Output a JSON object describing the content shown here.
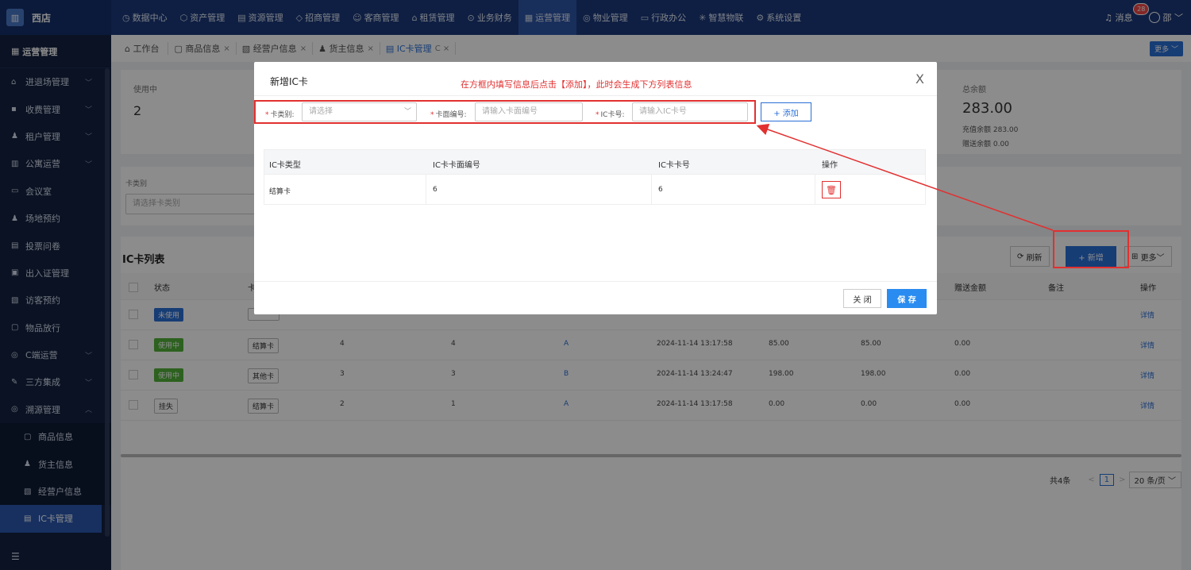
{
  "app": {
    "logo_icon": "building-icon",
    "store_name": "西店"
  },
  "topnav": [
    {
      "icon": "◷",
      "label": "数据中心"
    },
    {
      "icon": "⬡",
      "label": "资产管理"
    },
    {
      "icon": "▤",
      "label": "资源管理"
    },
    {
      "icon": "◇",
      "label": "招商管理"
    },
    {
      "icon": "☺",
      "label": "客商管理"
    },
    {
      "icon": "⌂",
      "label": "租赁管理"
    },
    {
      "icon": "⊙",
      "label": "业务财务"
    },
    {
      "icon": "▦",
      "label": "运营管理"
    },
    {
      "icon": "◎",
      "label": "物业管理"
    },
    {
      "icon": "▭",
      "label": "行政办公"
    },
    {
      "icon": "✳",
      "label": "智慧物联"
    },
    {
      "icon": "⚙",
      "label": "系统设置"
    }
  ],
  "topright": {
    "message_label": "消息",
    "message_count": "28",
    "user_name": "邵"
  },
  "sidebar": {
    "title": "运营管理",
    "items": [
      {
        "icon": "⌂",
        "label": "进退场管理",
        "chev": "﹀"
      },
      {
        "icon": "▪",
        "label": "收费管理",
        "chev": "﹀"
      },
      {
        "icon": "♟",
        "label": "租户管理",
        "chev": "﹀"
      },
      {
        "icon": "▥",
        "label": "公寓运营",
        "chev": "﹀"
      },
      {
        "icon": "▭",
        "label": "会议室",
        "chev": ""
      },
      {
        "icon": "♟",
        "label": "场地预约",
        "chev": ""
      },
      {
        "icon": "▤",
        "label": "投票问卷",
        "chev": ""
      },
      {
        "icon": "▣",
        "label": "出入证管理",
        "chev": ""
      },
      {
        "icon": "▧",
        "label": "访客预约",
        "chev": ""
      },
      {
        "icon": "▢",
        "label": "物品放行",
        "chev": ""
      },
      {
        "icon": "◎",
        "label": "C端运营",
        "chev": "﹀"
      },
      {
        "icon": "✎",
        "label": "三方集成",
        "chev": "﹀"
      },
      {
        "icon": "◎",
        "label": "溯源管理",
        "chev": "︿"
      }
    ],
    "subitems": [
      {
        "icon": "▢",
        "label": "商品信息"
      },
      {
        "icon": "♟",
        "label": "货主信息"
      },
      {
        "icon": "▧",
        "label": "经营户信息"
      },
      {
        "icon": "▤",
        "label": "IC卡管理"
      }
    ],
    "collapse_icon": "☰"
  },
  "tabs": [
    {
      "icon": "⌂",
      "label": "工作台",
      "close": ""
    },
    {
      "icon": "▢",
      "label": "商品信息",
      "close": "×"
    },
    {
      "icon": "▧",
      "label": "经营户信息",
      "close": "×"
    },
    {
      "icon": "♟",
      "label": "货主信息",
      "close": "×"
    },
    {
      "icon": "▤",
      "label": "IC卡管理",
      "close": "C ×"
    }
  ],
  "more_label": "更多 ﹀",
  "stats": {
    "used_label": "使用中",
    "used_value": "2",
    "total_label": "总余额",
    "total_value": "283.00",
    "recharge": "充值余额 283.00",
    "gift": "赠送余额 0.00"
  },
  "filter": {
    "label": "卡类别",
    "placeholder": "请选择卡类别"
  },
  "list": {
    "title": "IC卡列表",
    "refresh_label": "刷新",
    "add_label": "+ 新增",
    "more_label": "更多﹀",
    "headers": {
      "status": "状态",
      "type": "卡",
      "gift": "赠送金额",
      "remark": "备注",
      "op": "操作"
    },
    "rows": [
      {
        "status": "未使用",
        "type": "",
        "c3": "",
        "c4": "",
        "c5": "",
        "time": "",
        "amt1": "",
        "amt2": "",
        "gift": "",
        "op": "详情"
      },
      {
        "status": "使用中",
        "type": "结算卡",
        "c3": "4",
        "c4": "4",
        "c5": "A",
        "time": "2024-11-14 13:17:58",
        "amt1": "85.00",
        "amt2": "85.00",
        "gift": "0.00",
        "op": "详情"
      },
      {
        "status": "使用中",
        "type": "其他卡",
        "c3": "3",
        "c4": "3",
        "c5": "B",
        "time": "2024-11-14 13:24:47",
        "amt1": "198.00",
        "amt2": "198.00",
        "gift": "0.00",
        "op": "详情"
      },
      {
        "status": "挂失",
        "type": "结算卡",
        "c3": "2",
        "c4": "1",
        "c5": "A",
        "time": "2024-11-14 13:17:58",
        "amt1": "0.00",
        "amt2": "0.00",
        "gift": "0.00",
        "op": "详情"
      }
    ],
    "pager": {
      "total": "共4条",
      "prev": "<",
      "page": "1",
      "next": ">",
      "size": "20 条/页 ﹀"
    }
  },
  "modal": {
    "title": "新增IC卡",
    "annotation": "在方框内填写信息后点击【添加】，此时会生成下方列表信息",
    "close_icon": "X",
    "fields": {
      "type_label": "卡类别:",
      "type_placeholder": "请选择",
      "face_label": "卡面编号:",
      "face_placeholder": "请输入卡面编号",
      "card_label": "IC卡号:",
      "card_placeholder": "请输入IC卡号"
    },
    "add_label": "+ 添加",
    "table": {
      "headers": [
        "IC卡类型",
        "IC卡卡面编号",
        "IC卡卡号",
        "操作"
      ],
      "rows": [
        {
          "type": "结算卡",
          "face": "6",
          "card": "6"
        }
      ]
    },
    "close_label": "关 闭",
    "save_label": "保 存"
  },
  "colors": {
    "accent": "#2a6fd6",
    "nav_bg": "#1d3a7a",
    "sidebar_bg": "#132240",
    "annotation": "#e23030"
  }
}
